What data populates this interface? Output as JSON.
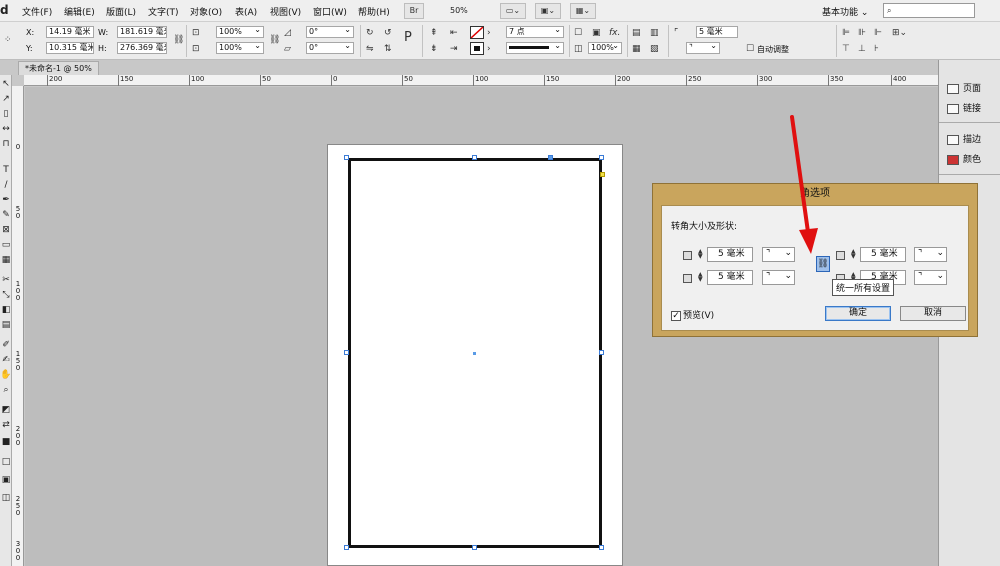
{
  "menubar": {
    "logo": "d",
    "items": [
      "文件(F)",
      "编辑(E)",
      "版面(L)",
      "文字(T)",
      "对象(O)",
      "表(A)",
      "视图(V)",
      "窗口(W)",
      "帮助(H)"
    ],
    "br_button": "Br",
    "zoom": "50%",
    "workspace": "基本功能",
    "search_icon": "search-icon"
  },
  "controlbar": {
    "x_label": "X:",
    "x_value": "14.19 毫米",
    "y_label": "Y:",
    "y_value": "10.315 毫米",
    "w_label": "W:",
    "w_value": "181.619 毫米",
    "h_label": "H:",
    "h_value": "276.369 毫米",
    "scale_x": "100%",
    "scale_y": "100%",
    "rotate": "0°",
    "shear": "0°",
    "stroke_weight": "7 点",
    "opacity": "100%",
    "corner_size": "5 毫米",
    "autofit_label": "自动调整"
  },
  "document_tab": "*未命名-1 @ 50%",
  "ruler": {
    "h_ticks": [
      "200",
      "150",
      "100",
      "50",
      "0",
      "50",
      "100",
      "150",
      "200",
      "250",
      "300",
      "350",
      "400"
    ],
    "v_ticks": [
      "0",
      "5 0",
      "1 0 0",
      "1 5 0",
      "2 0 0",
      "2 5 0",
      "3 0 0"
    ]
  },
  "panels": {
    "items": [
      "页面",
      "链接",
      "描边",
      "颜色"
    ]
  },
  "dialog": {
    "title": "角选项",
    "section": "转角大小及形状:",
    "tl_size": "5 毫米",
    "bl_size": "5 毫米",
    "tr_size": "5 毫米",
    "br_size": "5 毫米",
    "tooltip": "统一所有设置",
    "preview_label": "预览(V)",
    "ok_label": "确定",
    "cancel_label": "取消"
  }
}
